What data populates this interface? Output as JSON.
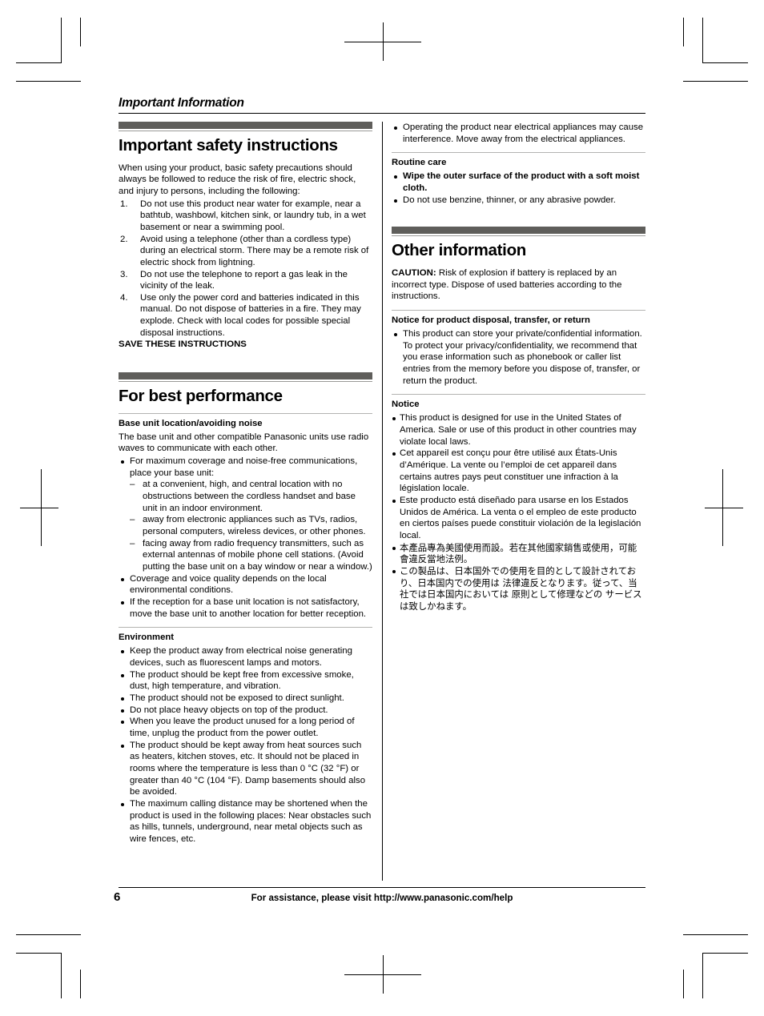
{
  "running_head": "Important Information",
  "left_column": {
    "section1": {
      "title": "Important safety instructions",
      "intro": "When using your product, basic safety precautions should always be followed to reduce the risk of fire, electric shock, and injury to persons, including the following:",
      "numbered_items": [
        {
          "num": "1.",
          "text": "Do not use this product near water for example, near a bathtub, washbowl, kitchen sink, or laundry tub, in a wet basement or near a swimming pool."
        },
        {
          "num": "2.",
          "text": "Avoid using a telephone (other than a cordless type) during an electrical storm. There may be a remote risk of electric shock from lightning."
        },
        {
          "num": "3.",
          "text": "Do not use the telephone to report a gas leak in the vicinity of the leak."
        },
        {
          "num": "4.",
          "text": "Use only the power cord and batteries indicated in this manual. Do not dispose of batteries in a fire. They may explode. Check with local codes for possible special disposal instructions."
        }
      ],
      "save_notice": "SAVE THESE INSTRUCTIONS"
    },
    "section2": {
      "title": "For best performance",
      "sub1": {
        "title": "Base unit location/avoiding noise",
        "intro": "The base unit and other compatible Panasonic units use radio waves to communicate with each other.",
        "bullet1": "For maximum coverage and noise-free communications, place your base unit:",
        "dashes": [
          "at a convenient, high, and central location with no obstructions between the cordless handset and base unit in an indoor environment.",
          "away from electronic appliances such as TVs, radios, personal computers, wireless devices, or other phones.",
          "facing away from radio frequency transmitters, such as external antennas of mobile phone cell stations. (Avoid putting the base unit on a bay window or near a window.)"
        ],
        "bullets_after": [
          "Coverage and voice quality depends on the local environmental conditions.",
          "If the reception for a base unit location is not satisfactory, move the base unit to another location for better reception."
        ]
      },
      "sub2": {
        "title": "Environment",
        "bullets": [
          "Keep the product away from electrical noise generating devices, such as fluorescent lamps and motors.",
          "The product should be kept free from excessive smoke, dust, high temperature, and vibration.",
          "The product should not be exposed to direct sunlight.",
          "Do not place heavy objects on top of the product.",
          "When you leave the product unused for a long period of time, unplug the product from the power outlet.",
          "The product should be kept away from heat sources such as heaters, kitchen stoves, etc. It should not be placed in rooms where the temperature is less than 0 °C (32 °F) or greater than 40 °C (104 °F). Damp basements should also be avoided.",
          "The maximum calling distance may be shortened when the product is used in the following places: Near obstacles such as hills, tunnels, underground, near metal objects such as wire fences, etc."
        ]
      }
    }
  },
  "right_column": {
    "top_bullet": "Operating the product near electrical appliances may cause interference. Move away from the electrical appliances.",
    "routine_care": {
      "title": "Routine care",
      "bullets": [
        {
          "text": "Wipe the outer surface of the product with a soft moist cloth.",
          "bold": true
        },
        {
          "text": "Do not use benzine, thinner, or any abrasive powder.",
          "bold": false
        }
      ]
    },
    "section3": {
      "title": "Other information",
      "caution_label": "CAUTION:",
      "caution_text": " Risk of explosion if battery is replaced by an incorrect type. Dispose of used batteries according to the instructions.",
      "disposal": {
        "title": "Notice for product disposal, transfer, or return",
        "bullet": "This product can store your private/confidential information. To protect your privacy/confidentiality, we recommend that you erase information such as phonebook or caller list entries from the memory before you dispose of, transfer, or return the product."
      },
      "notice": {
        "title": "Notice",
        "items": [
          {
            "lang": "en",
            "text": "This product is designed for use in the United States of America. Sale or use of this product in other countries may violate local laws."
          },
          {
            "lang": "fr",
            "text": "Cet appareil est conçu pour être utilisé aux États-Unis d’Amérique. La vente ou l’emploi de cet appareil dans certains autres pays peut constituer une infraction à la législation locale."
          },
          {
            "lang": "es",
            "text": "Este producto está diseñado para usarse en los Estados Unidos de América. La venta o el empleo de este producto en ciertos países puede constituir violación de la legislación local."
          },
          {
            "lang": "zh",
            "text": "本產品專為美國使用而設。若在其他國家銷售或使用，可能會違反當地法例。"
          },
          {
            "lang": "ja",
            "text": "この製品は、日本国外での使用を目的として設計されており、日本国内での使用は 法律違反となります。従って、当社では日本国内においては 原則として修理などの サービスは致しかねます。"
          }
        ]
      }
    }
  },
  "footer": {
    "page_number": "6",
    "text": "For assistance, please visit http://www.panasonic.com/help"
  }
}
